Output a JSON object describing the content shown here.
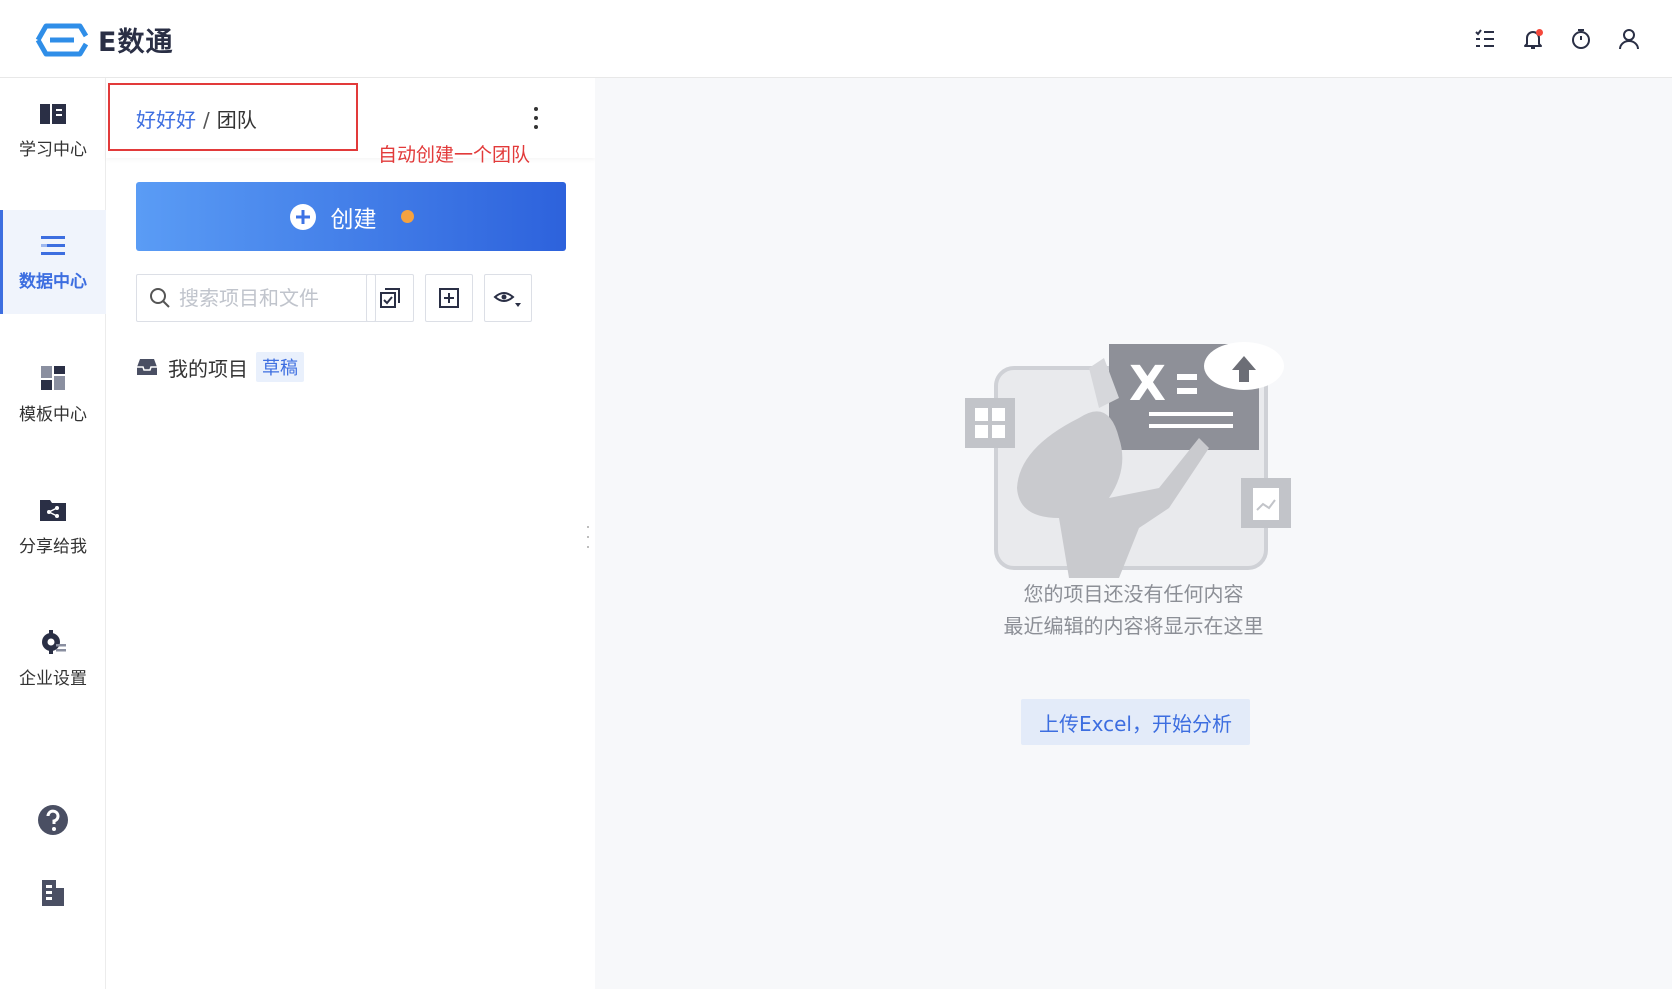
{
  "app": {
    "name": "E数通"
  },
  "topbar": {
    "icons": [
      "tasks-icon",
      "bell-icon",
      "timer-icon",
      "user-icon"
    ]
  },
  "leftnav": {
    "items": [
      {
        "label": "学习中心",
        "icon": "book-icon",
        "active": false
      },
      {
        "label": "数据中心",
        "icon": "list-icon",
        "active": true
      },
      {
        "label": "模板中心",
        "icon": "template-icon",
        "active": false
      },
      {
        "label": "分享给我",
        "icon": "share-folder-icon",
        "active": false
      },
      {
        "label": "企业设置",
        "icon": "settings-icon",
        "active": false
      }
    ],
    "bottom": [
      "help-icon",
      "building-icon"
    ]
  },
  "panel": {
    "breadcrumb": {
      "team": "好好好",
      "separator": "/",
      "current": "团队"
    },
    "annotation": "自动创建一个团队",
    "create_label": "创建",
    "search_placeholder": "搜索项目和文件",
    "project": {
      "label": "我的项目",
      "badge": "草稿"
    }
  },
  "main": {
    "empty_line1": "您的项目还没有任何内容",
    "empty_line2": "最近编辑的内容将显示在这里",
    "upload_label": "上传Excel，开始分析"
  },
  "colors": {
    "accent": "#3d6ee0",
    "annotation": "#e23a3a",
    "dot": "#f5a240"
  }
}
